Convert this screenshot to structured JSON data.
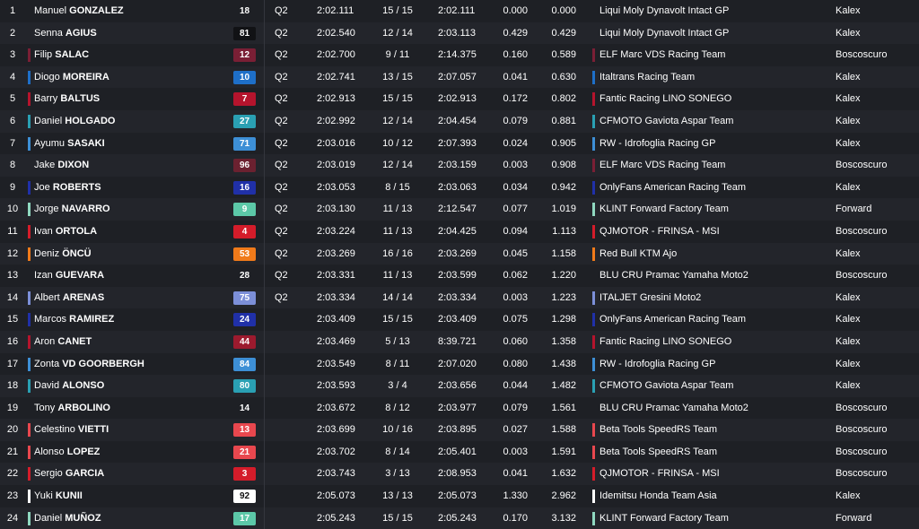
{
  "rows": [
    {
      "pos": "1",
      "first": "Manuel",
      "last": "GONZALEZ",
      "num": "18",
      "numBg": "",
      "numColor": "#ffffff",
      "riderColor": "",
      "session": "Q2",
      "best": "2:02.111",
      "laps": "15 / 15",
      "lastLap": "2:02.111",
      "gap": "0.000",
      "diff": "0.000",
      "team": "Liqui Moly Dynavolt Intact GP",
      "teamColor": "",
      "cons": "Kalex"
    },
    {
      "pos": "2",
      "first": "Senna",
      "last": "AGIUS",
      "num": "81",
      "numBg": "#111215",
      "numColor": "#ffffff",
      "riderColor": "",
      "session": "Q2",
      "best": "2:02.540",
      "laps": "12 / 14",
      "lastLap": "2:03.113",
      "gap": "0.429",
      "diff": "0.429",
      "team": "Liqui Moly Dynavolt Intact GP",
      "teamColor": "",
      "cons": "Kalex"
    },
    {
      "pos": "3",
      "first": "Filip",
      "last": "SALAC",
      "num": "12",
      "numBg": "#7a1f35",
      "numColor": "#ffffff",
      "riderColor": "#7a1f35",
      "session": "Q2",
      "best": "2:02.700",
      "laps": "9 / 11",
      "lastLap": "2:14.375",
      "gap": "0.160",
      "diff": "0.589",
      "team": "ELF Marc VDS Racing Team",
      "teamColor": "#7a1f35",
      "cons": "Boscoscuro"
    },
    {
      "pos": "4",
      "first": "Diogo",
      "last": "MOREIRA",
      "num": "10",
      "numBg": "#1e6fc8",
      "numColor": "#ffffff",
      "riderColor": "#1e6fc8",
      "session": "Q2",
      "best": "2:02.741",
      "laps": "13 / 15",
      "lastLap": "2:07.057",
      "gap": "0.041",
      "diff": "0.630",
      "team": "Italtrans Racing Team",
      "teamColor": "#1e6fc8",
      "cons": "Kalex"
    },
    {
      "pos": "5",
      "first": "Barry",
      "last": "BALTUS",
      "num": "7",
      "numBg": "#b5142d",
      "numColor": "#ffffff",
      "riderColor": "#b5142d",
      "session": "Q2",
      "best": "2:02.913",
      "laps": "15 / 15",
      "lastLap": "2:02.913",
      "gap": "0.172",
      "diff": "0.802",
      "team": "Fantic Racing LINO SONEGO",
      "teamColor": "#b5142d",
      "cons": "Kalex"
    },
    {
      "pos": "6",
      "first": "Daniel",
      "last": "HOLGADO",
      "num": "27",
      "numBg": "#2aa0b3",
      "numColor": "#ffffff",
      "riderColor": "#2aa0b3",
      "session": "Q2",
      "best": "2:02.992",
      "laps": "12 / 14",
      "lastLap": "2:04.454",
      "gap": "0.079",
      "diff": "0.881",
      "team": "CFMOTO Gaviota Aspar Team",
      "teamColor": "#2aa0b3",
      "cons": "Kalex"
    },
    {
      "pos": "7",
      "first": "Ayumu",
      "last": "SASAKI",
      "num": "71",
      "numBg": "#3d8fd6",
      "numColor": "#ffffff",
      "riderColor": "#3d8fd6",
      "session": "Q2",
      "best": "2:03.016",
      "laps": "10 / 12",
      "lastLap": "2:07.393",
      "gap": "0.024",
      "diff": "0.905",
      "team": "RW - Idrofoglia Racing GP",
      "teamColor": "#3d8fd6",
      "cons": "Kalex"
    },
    {
      "pos": "8",
      "first": "Jake",
      "last": "DIXON",
      "num": "96",
      "numBg": "#6b2130",
      "numColor": "#ffffff",
      "riderColor": "",
      "session": "Q2",
      "best": "2:03.019",
      "laps": "12 / 14",
      "lastLap": "2:03.159",
      "gap": "0.003",
      "diff": "0.908",
      "team": "ELF Marc VDS Racing Team",
      "teamColor": "#7a1f35",
      "cons": "Boscoscuro"
    },
    {
      "pos": "9",
      "first": "Joe",
      "last": "ROBERTS",
      "num": "16",
      "numBg": "#2030a8",
      "numColor": "#ffffff",
      "riderColor": "#2030a8",
      "session": "Q2",
      "best": "2:03.053",
      "laps": "8 / 15",
      "lastLap": "2:03.063",
      "gap": "0.034",
      "diff": "0.942",
      "team": "OnlyFans American Racing Team",
      "teamColor": "#2030a8",
      "cons": "Kalex"
    },
    {
      "pos": "10",
      "first": "Jorge",
      "last": "NAVARRO",
      "num": "9",
      "numBg": "#5cc8a8",
      "numColor": "#ffffff",
      "riderColor": "#8fd8c0",
      "session": "Q2",
      "best": "2:03.130",
      "laps": "11 / 13",
      "lastLap": "2:12.547",
      "gap": "0.077",
      "diff": "1.019",
      "team": "KLINT Forward Factory Team",
      "teamColor": "#8fd8c0",
      "cons": "Forward"
    },
    {
      "pos": "11",
      "first": "Ivan",
      "last": "ORTOLA",
      "num": "4",
      "numBg": "#d41c2a",
      "numColor": "#ffffff",
      "riderColor": "#d41c2a",
      "session": "Q2",
      "best": "2:03.224",
      "laps": "11 / 13",
      "lastLap": "2:04.425",
      "gap": "0.094",
      "diff": "1.113",
      "team": "QJMOTOR - FRINSA - MSI",
      "teamColor": "#d41c2a",
      "cons": "Boscoscuro"
    },
    {
      "pos": "12",
      "first": "Deniz",
      "last": "ÖNCÜ",
      "num": "53",
      "numBg": "#f07a1a",
      "numColor": "#ffffff",
      "riderColor": "#f07a1a",
      "session": "Q2",
      "best": "2:03.269",
      "laps": "16 / 16",
      "lastLap": "2:03.269",
      "gap": "0.045",
      "diff": "1.158",
      "team": "Red Bull KTM Ajo",
      "teamColor": "#f07a1a",
      "cons": "Kalex"
    },
    {
      "pos": "13",
      "first": "Izan",
      "last": "GUEVARA",
      "num": "28",
      "numBg": "",
      "numColor": "#ffffff",
      "riderColor": "",
      "session": "Q2",
      "best": "2:03.331",
      "laps": "11 / 13",
      "lastLap": "2:03.599",
      "gap": "0.062",
      "diff": "1.220",
      "team": "BLU CRU Pramac Yamaha Moto2",
      "teamColor": "",
      "cons": "Boscoscuro"
    },
    {
      "pos": "14",
      "first": "Albert",
      "last": "ARENAS",
      "num": "75",
      "numBg": "#7c8fd8",
      "numColor": "#ffffff",
      "riderColor": "#7c8fd8",
      "session": "Q2",
      "best": "2:03.334",
      "laps": "14 / 14",
      "lastLap": "2:03.334",
      "gap": "0.003",
      "diff": "1.223",
      "team": "ITALJET Gresini Moto2",
      "teamColor": "#7c8fd8",
      "cons": "Kalex"
    },
    {
      "pos": "15",
      "first": "Marcos",
      "last": "RAMIREZ",
      "num": "24",
      "numBg": "#2030a8",
      "numColor": "#ffffff",
      "riderColor": "#2030a8",
      "session": "",
      "best": "2:03.409",
      "laps": "15 / 15",
      "lastLap": "2:03.409",
      "gap": "0.075",
      "diff": "1.298",
      "team": "OnlyFans American Racing Team",
      "teamColor": "#2030a8",
      "cons": "Kalex"
    },
    {
      "pos": "16",
      "first": "Aron",
      "last": "CANET",
      "num": "44",
      "numBg": "#9c1a2e",
      "numColor": "#ffffff",
      "riderColor": "#b5142d",
      "session": "",
      "best": "2:03.469",
      "laps": "5 / 13",
      "lastLap": "8:39.721",
      "gap": "0.060",
      "diff": "1.358",
      "team": "Fantic Racing LINO SONEGO",
      "teamColor": "#b5142d",
      "cons": "Kalex"
    },
    {
      "pos": "17",
      "first": "Zonta",
      "last": "VD GOORBERGH",
      "num": "84",
      "numBg": "#3d8fd6",
      "numColor": "#ffffff",
      "riderColor": "#3d8fd6",
      "session": "",
      "best": "2:03.549",
      "laps": "8 / 11",
      "lastLap": "2:07.020",
      "gap": "0.080",
      "diff": "1.438",
      "team": "RW - Idrofoglia Racing GP",
      "teamColor": "#3d8fd6",
      "cons": "Kalex"
    },
    {
      "pos": "18",
      "first": "David",
      "last": "ALONSO",
      "num": "80",
      "numBg": "#2aa0b3",
      "numColor": "#ffffff",
      "riderColor": "#2aa0b3",
      "session": "",
      "best": "2:03.593",
      "laps": "3 / 4",
      "lastLap": "2:03.656",
      "gap": "0.044",
      "diff": "1.482",
      "team": "CFMOTO Gaviota Aspar Team",
      "teamColor": "#2aa0b3",
      "cons": "Kalex"
    },
    {
      "pos": "19",
      "first": "Tony",
      "last": "ARBOLINO",
      "num": "14",
      "numBg": "",
      "numColor": "#ffffff",
      "riderColor": "",
      "session": "",
      "best": "2:03.672",
      "laps": "8 / 12",
      "lastLap": "2:03.977",
      "gap": "0.079",
      "diff": "1.561",
      "team": "BLU CRU Pramac Yamaha Moto2",
      "teamColor": "",
      "cons": "Boscoscuro"
    },
    {
      "pos": "20",
      "first": "Celestino",
      "last": "VIETTI",
      "num": "13",
      "numBg": "#e8474e",
      "numColor": "#ffffff",
      "riderColor": "#e8474e",
      "session": "",
      "best": "2:03.699",
      "laps": "10 / 16",
      "lastLap": "2:03.895",
      "gap": "0.027",
      "diff": "1.588",
      "team": "Beta Tools SpeedRS Team",
      "teamColor": "#e8474e",
      "cons": "Boscoscuro"
    },
    {
      "pos": "21",
      "first": "Alonso",
      "last": "LOPEZ",
      "num": "21",
      "numBg": "#e8474e",
      "numColor": "#ffffff",
      "riderColor": "#e8474e",
      "session": "",
      "best": "2:03.702",
      "laps": "8 / 14",
      "lastLap": "2:05.401",
      "gap": "0.003",
      "diff": "1.591",
      "team": "Beta Tools SpeedRS Team",
      "teamColor": "#e8474e",
      "cons": "Boscoscuro"
    },
    {
      "pos": "22",
      "first": "Sergio",
      "last": "GARCIA",
      "num": "3",
      "numBg": "#d41c2a",
      "numColor": "#ffffff",
      "riderColor": "#d41c2a",
      "session": "",
      "best": "2:03.743",
      "laps": "3 / 13",
      "lastLap": "2:08.953",
      "gap": "0.041",
      "diff": "1.632",
      "team": "QJMOTOR - FRINSA - MSI",
      "teamColor": "#d41c2a",
      "cons": "Boscoscuro"
    },
    {
      "pos": "23",
      "first": "Yuki",
      "last": "KUNII",
      "num": "92",
      "numBg": "#ffffff",
      "numColor": "#111111",
      "riderColor": "#ffffff",
      "session": "",
      "best": "2:05.073",
      "laps": "13 / 13",
      "lastLap": "2:05.073",
      "gap": "1.330",
      "diff": "2.962",
      "team": "Idemitsu Honda Team Asia",
      "teamColor": "#ffffff",
      "cons": "Kalex"
    },
    {
      "pos": "24",
      "first": "Daniel",
      "last": "MUÑOZ",
      "num": "17",
      "numBg": "#5cc8a8",
      "numColor": "#ffffff",
      "riderColor": "#8fd8c0",
      "session": "",
      "best": "2:05.243",
      "laps": "15 / 15",
      "lastLap": "2:05.243",
      "gap": "0.170",
      "diff": "3.132",
      "team": "KLINT Forward Factory Team",
      "teamColor": "#8fd8c0",
      "cons": "Forward"
    }
  ]
}
